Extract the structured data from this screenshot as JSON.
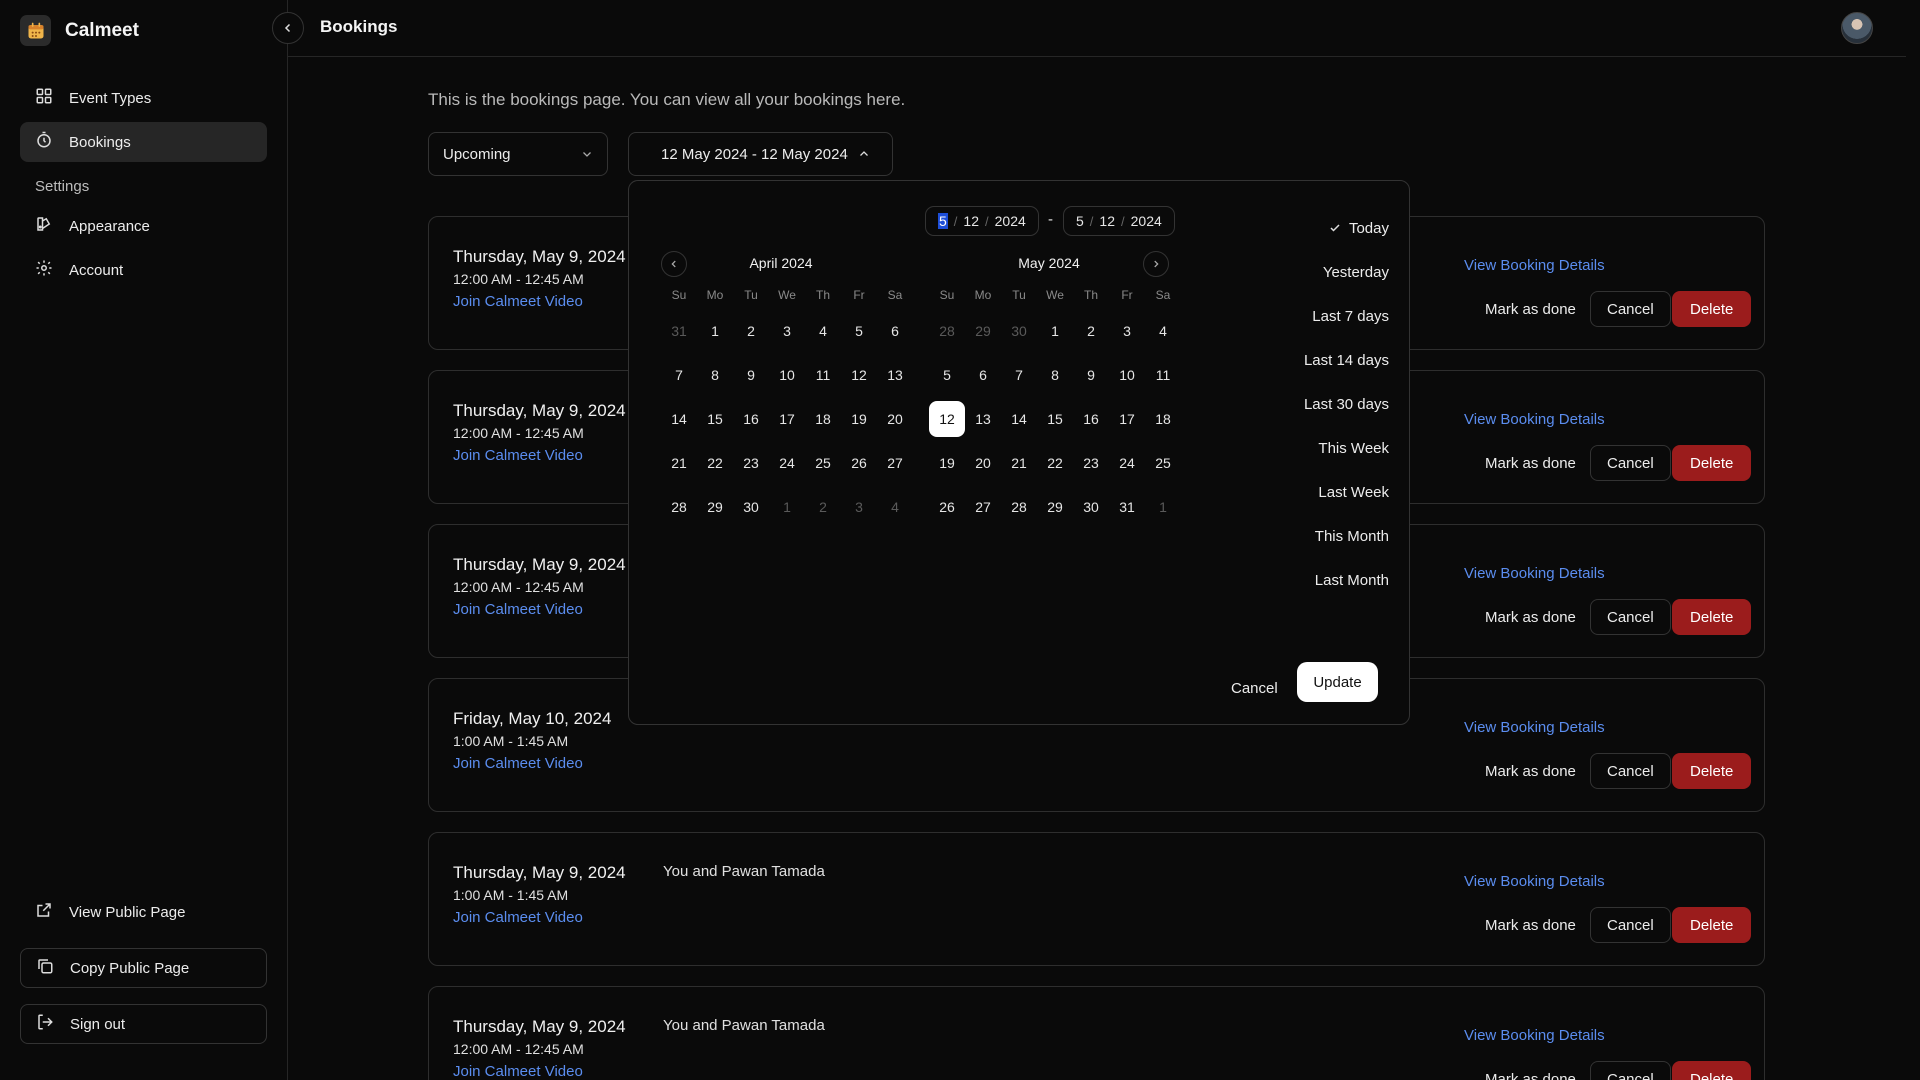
{
  "app": {
    "name": "Calmeet"
  },
  "sidebar": {
    "items": [
      {
        "label": "Event Types",
        "icon": "grid-icon"
      },
      {
        "label": "Bookings",
        "icon": "timer-icon",
        "active": true
      }
    ],
    "settings_label": "Settings",
    "settings_items": [
      {
        "label": "Appearance",
        "icon": "palette-icon"
      },
      {
        "label": "Account",
        "icon": "gear-icon"
      }
    ],
    "bottom": {
      "view_public": "View Public Page",
      "copy_public": "Copy Public Page",
      "sign_out": "Sign out"
    }
  },
  "header": {
    "title": "Bookings"
  },
  "main": {
    "intro": "This is the bookings page. You can view all your bookings here.",
    "filter_value": "Upcoming",
    "date_range": "12 May 2024 - 12 May 2024"
  },
  "bookings": [
    {
      "date": "Thursday, May 9, 2024",
      "time": "12:00 AM - 12:45 AM",
      "link": "Join Calmeet Video",
      "title": ""
    },
    {
      "date": "Thursday, May 9, 2024",
      "time": "12:00 AM - 12:45 AM",
      "link": "Join Calmeet Video",
      "title": ""
    },
    {
      "date": "Thursday, May 9, 2024",
      "time": "12:00 AM - 12:45 AM",
      "link": "Join Calmeet Video",
      "title": ""
    },
    {
      "date": "Friday, May 10, 2024",
      "time": "1:00 AM - 1:45 AM",
      "link": "Join Calmeet Video",
      "title": ""
    },
    {
      "date": "Thursday, May 9, 2024",
      "time": "1:00 AM - 1:45 AM",
      "link": "Join Calmeet Video",
      "title": "You and Pawan Tamada"
    },
    {
      "date": "Thursday, May 9, 2024",
      "time": "12:00 AM - 12:45 AM",
      "link": "Join Calmeet Video",
      "title": "You and Pawan Tamada"
    }
  ],
  "booking_actions": {
    "details": "View Booking Details",
    "done": "Mark as done",
    "cancel": "Cancel",
    "delete": "Delete"
  },
  "picker": {
    "start": {
      "month": "5",
      "day": "12",
      "year": "2024"
    },
    "end": {
      "month": "5",
      "day": "12",
      "year": "2024"
    },
    "dash": "-",
    "date_sep": "/",
    "weekdays": [
      "Su",
      "Mo",
      "Tu",
      "We",
      "Th",
      "Fr",
      "Sa"
    ],
    "months": [
      {
        "title": "April 2024",
        "days": [
          {
            "d": "31",
            "muted": true
          },
          {
            "d": "1"
          },
          {
            "d": "2"
          },
          {
            "d": "3"
          },
          {
            "d": "4"
          },
          {
            "d": "5"
          },
          {
            "d": "6"
          },
          {
            "d": "7"
          },
          {
            "d": "8"
          },
          {
            "d": "9"
          },
          {
            "d": "10"
          },
          {
            "d": "11"
          },
          {
            "d": "12"
          },
          {
            "d": "13"
          },
          {
            "d": "14"
          },
          {
            "d": "15"
          },
          {
            "d": "16"
          },
          {
            "d": "17"
          },
          {
            "d": "18"
          },
          {
            "d": "19"
          },
          {
            "d": "20"
          },
          {
            "d": "21"
          },
          {
            "d": "22"
          },
          {
            "d": "23"
          },
          {
            "d": "24"
          },
          {
            "d": "25"
          },
          {
            "d": "26"
          },
          {
            "d": "27"
          },
          {
            "d": "28"
          },
          {
            "d": "29"
          },
          {
            "d": "30"
          },
          {
            "d": "1",
            "muted": true
          },
          {
            "d": "2",
            "muted": true
          },
          {
            "d": "3",
            "muted": true
          },
          {
            "d": "4",
            "muted": true
          }
        ]
      },
      {
        "title": "May 2024",
        "days": [
          {
            "d": "28",
            "muted": true
          },
          {
            "d": "29",
            "muted": true
          },
          {
            "d": "30",
            "muted": true
          },
          {
            "d": "1"
          },
          {
            "d": "2"
          },
          {
            "d": "3"
          },
          {
            "d": "4"
          },
          {
            "d": "5"
          },
          {
            "d": "6"
          },
          {
            "d": "7"
          },
          {
            "d": "8"
          },
          {
            "d": "9"
          },
          {
            "d": "10"
          },
          {
            "d": "11"
          },
          {
            "d": "12",
            "selected": true
          },
          {
            "d": "13"
          },
          {
            "d": "14"
          },
          {
            "d": "15"
          },
          {
            "d": "16"
          },
          {
            "d": "17"
          },
          {
            "d": "18"
          },
          {
            "d": "19"
          },
          {
            "d": "20"
          },
          {
            "d": "21"
          },
          {
            "d": "22"
          },
          {
            "d": "23"
          },
          {
            "d": "24"
          },
          {
            "d": "25"
          },
          {
            "d": "26"
          },
          {
            "d": "27"
          },
          {
            "d": "28"
          },
          {
            "d": "29"
          },
          {
            "d": "30"
          },
          {
            "d": "31"
          },
          {
            "d": "1",
            "muted": true
          }
        ]
      }
    ],
    "presets": [
      {
        "label": "Today",
        "checked": true
      },
      {
        "label": "Yesterday"
      },
      {
        "label": "Last 7 days"
      },
      {
        "label": "Last 14 days"
      },
      {
        "label": "Last 30 days"
      },
      {
        "label": "This Week"
      },
      {
        "label": "Last Week"
      },
      {
        "label": "This Month"
      },
      {
        "label": "Last Month"
      }
    ],
    "cancel_label": "Cancel",
    "update_label": "Update"
  },
  "colors": {
    "accent_link": "#5b8def",
    "delete": "#9b1c1c",
    "background": "#0a0a0a"
  }
}
